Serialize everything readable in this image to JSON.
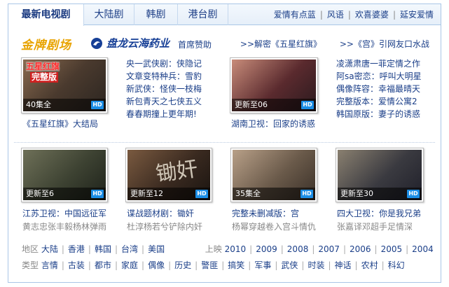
{
  "tabs": [
    "最新电视剧",
    "大陆剧",
    "韩剧",
    "港台剧"
  ],
  "top_links": [
    "爱情有点蓝",
    "风语",
    "欢喜婆婆",
    "延安爱情"
  ],
  "promo": {
    "gold_title": "金牌剧场",
    "pharma_name": "盘龙云海药业",
    "sponsor": "首席赞助",
    "link1": ">>解密《五星红旗》",
    "link2": ">>《宫》引网友口水战"
  },
  "featured": [
    {
      "badge": "40集全",
      "hd": "HD",
      "overlay_top": "五星红旗",
      "overlay_bottom": "完整版",
      "caption": "《五星红旗》大结局",
      "colors": [
        "#4a3a2e",
        "#8a6b50",
        "#2b2520"
      ]
    },
    {
      "badge": "更新至06",
      "hd": "HD",
      "caption": "湖南卫视：回家的诱惑",
      "colors": [
        "#5a2a2e",
        "#c88c7a",
        "#2a1a1e"
      ]
    }
  ],
  "list_mid": [
    "央一武侠剧：侠隐记",
    "文章变特种兵：雪豹",
    "新武侠：怪侠一枝梅",
    "新包青天之七侠五义",
    "春春期撞上更年期!"
  ],
  "list_right": [
    "凌潇肃唐一菲定情之作",
    "阿sa密恋：呼叫大明星",
    "偶像阵容：幸福最晴天",
    "完整版本：爱情公寓2",
    "韩国原版：妻子的诱惑"
  ],
  "row2": [
    {
      "badge": "更新至6",
      "hd": "HD",
      "caption": "江苏卫视：中国远征军",
      "sub": "黄志忠张丰毅杨林弹雨",
      "colors": [
        "#3d4232",
        "#6e7058",
        "#1e221a"
      ]
    },
    {
      "badge": "更新至12",
      "hd": "HD",
      "calligraphy": "锄奸",
      "caption": "谍战题材剧：锄奸",
      "sub": "杜淳杨若兮铲除内奸",
      "colors": [
        "#3a2a20",
        "#7a5a40",
        "#1a1410"
      ]
    },
    {
      "badge": "35集全",
      "hd": "HD",
      "caption": "完整未删减版：宫",
      "sub": "杨幂穿越卷入宫斗情仇",
      "colors": [
        "#6a5a4a",
        "#b8a088",
        "#3a3028"
      ]
    },
    {
      "badge": "更新至30",
      "hd": "HD",
      "caption": "四大卫视：你是我兄弟",
      "sub": "张嘉译邓超手足情深",
      "colors": [
        "#3a3a40",
        "#8a8070",
        "#20202a"
      ]
    }
  ],
  "filters": {
    "region_label": "地区",
    "regions": [
      "大陆",
      "香港",
      "韩国",
      "台湾",
      "美国"
    ],
    "year_label": "上映",
    "years": [
      "2010",
      "2009",
      "2008",
      "2007",
      "2006",
      "2005",
      "2004"
    ],
    "type_label": "类型",
    "types": [
      "言情",
      "古装",
      "都市",
      "家庭",
      "偶像",
      "历史",
      "警匪",
      "搞笑",
      "军事",
      "武侠",
      "时装",
      "神话",
      "农村",
      "科幻"
    ]
  }
}
